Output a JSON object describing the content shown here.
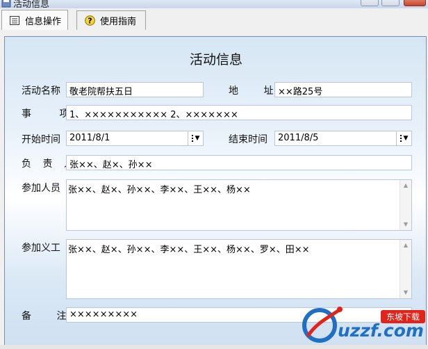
{
  "window": {
    "title": "活动信息"
  },
  "tabs": [
    {
      "label": "信息操作",
      "icon": "list-icon",
      "active": true
    },
    {
      "label": "使用指南",
      "icon": "help-icon",
      "active": false
    }
  ],
  "form": {
    "title": "活动信息",
    "activity_name_label": "活动名称",
    "activity_name": "敬老院帮扶五日",
    "address_label": "地 址",
    "address": "××路25号",
    "items_label": "事 项",
    "items": "1、××××××××××× 2、×××××××",
    "start_time_label": "开始时间",
    "start_time": "2011/8/1",
    "end_time_label": "结束时间",
    "end_time": "2011/8/5",
    "leader_label": "负 责 人",
    "leader": "张××、赵×、孙××",
    "participants_label": "参加人员",
    "participants": "张××、赵×、孙××、李××、王××、杨××",
    "volunteers_label": "参加义工",
    "volunteers": "张××、赵×、孙××、李××、王××、杨××、罗×、田××",
    "notes_label": "备 注",
    "notes": "×××××××××"
  },
  "watermark": {
    "brand": "uzzf.com",
    "tag": "东坡下载"
  },
  "colors": {
    "frame_border": "#7a8ea8",
    "watermark_blue": "#1f6fc5",
    "watermark_red": "#e2231a"
  }
}
